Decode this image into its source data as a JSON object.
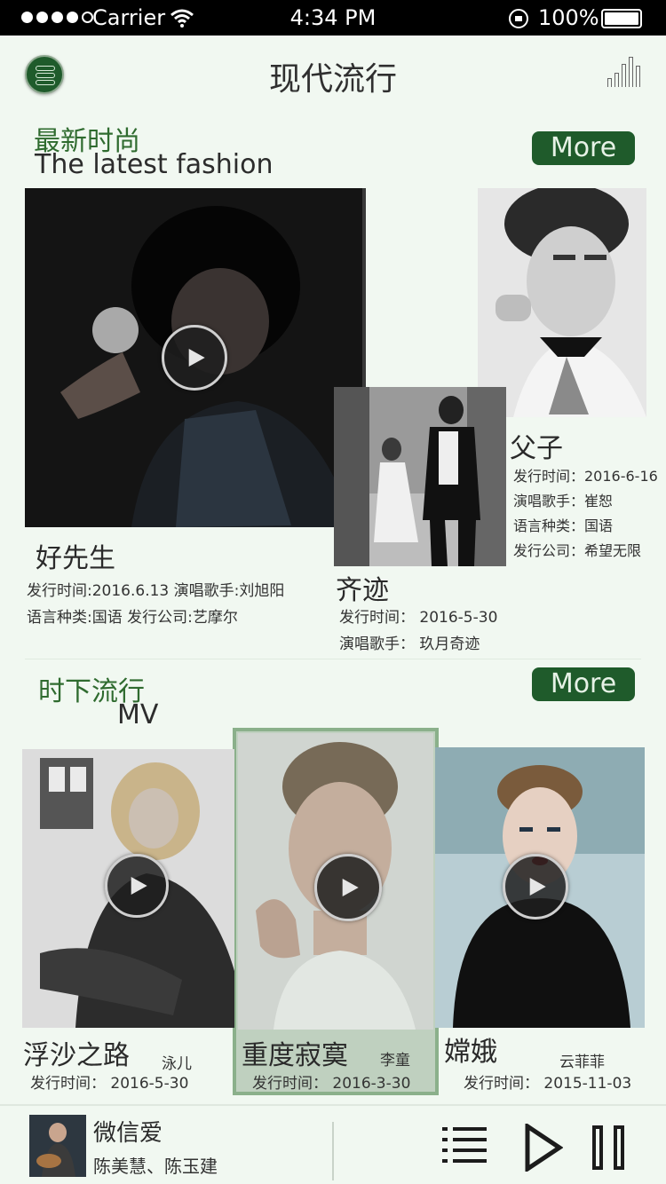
{
  "status": {
    "carrier": "Carrier",
    "time": "4:34 PM",
    "battery": "100%"
  },
  "header": {
    "title": "现代流行"
  },
  "latest": {
    "title_zh": "最新时尚",
    "title_en": "The latest fashion",
    "more": "More",
    "items": [
      {
        "title": "好先生",
        "line1": "发行时间:2016.6.13    演唱歌手:刘旭阳",
        "line2": "语言种类:国语     发行公司:艺摩尔"
      },
      {
        "title": "齐迹",
        "date": "发行时间：  2016-5-30",
        "singer": "演唱歌手：  玖月奇迹"
      },
      {
        "title": "父子",
        "date": "发行时间：2016-6-16",
        "singer": "演唱歌手：崔恕",
        "language": "语言种类：国语",
        "company": "发行公司：希望无限"
      }
    ]
  },
  "mv": {
    "title_zh": "时下流行",
    "title_en": "MV",
    "more": "More",
    "items": [
      {
        "title": "浮沙之路",
        "artist": "泳儿",
        "date": "发行时间：  2016-5-30"
      },
      {
        "title": "重度寂寞",
        "artist": "李童",
        "date": "发行时间：  2016-3-30"
      },
      {
        "title": "嫦娥",
        "artist": "云菲菲",
        "date": "发行时间：  2015-11-03"
      }
    ]
  },
  "player": {
    "song": "微信爱",
    "artist": "陈美慧、陈玉建"
  },
  "icons": {
    "menu": "menu-icon",
    "chart": "bar-chart-icon",
    "play": "play-icon",
    "list": "list-icon",
    "pause": "pause-icon"
  },
  "colors": {
    "accent": "#1f5b2b",
    "background": "#f1f8f1",
    "section_title": "#2f6b2f"
  }
}
